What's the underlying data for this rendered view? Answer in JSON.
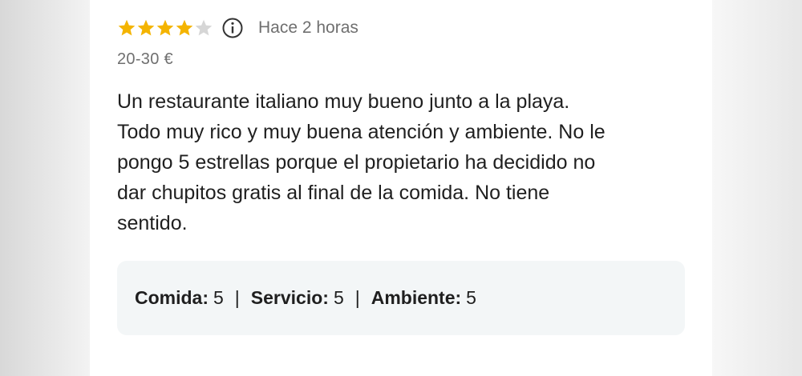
{
  "review": {
    "rating": 4,
    "rating_max": 5,
    "time_ago": "Hace 2 horas",
    "price_range": "20-30 €",
    "text": "Un restaurante italiano muy bueno junto a la playa.\nTodo muy rico y muy buena atención y ambiente. No le\npongo 5 estrellas porque el propietario ha decidido no\ndar chupitos gratis al final de la comida. No tiene\nsentido.",
    "scores": [
      {
        "label": "Comida:",
        "value": "5"
      },
      {
        "label": "Servicio:",
        "value": "5"
      },
      {
        "label": "Ambiente:",
        "value": "5"
      }
    ],
    "separator": "|"
  },
  "icons": {
    "star_filled": "star-icon",
    "star_empty": "star-empty-icon",
    "info": "info-icon"
  },
  "colors": {
    "star_filled": "#f4b400",
    "star_empty": "#d6d6d6",
    "scores_background": "#f3f6f7"
  }
}
